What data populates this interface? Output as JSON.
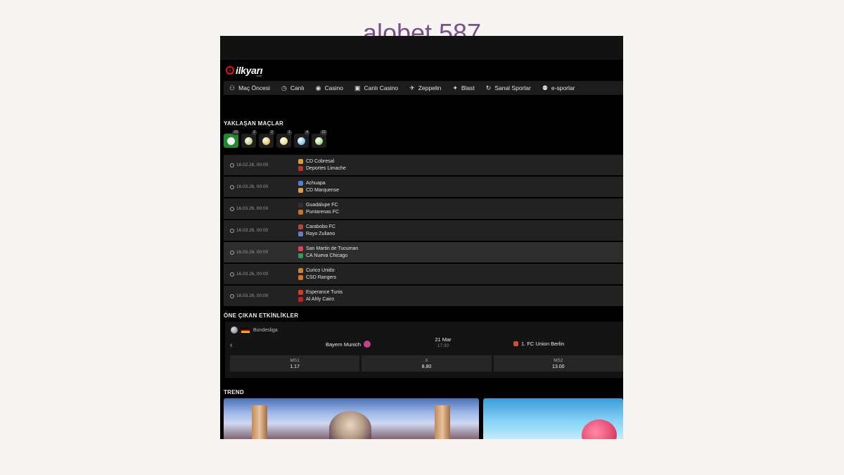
{
  "page_title": "alobet 587",
  "site": {
    "logo_text": "ilkyarı",
    "logo_sub": ".com"
  },
  "nav": [
    {
      "label": "Maç Öncesi",
      "icon": "users-icon",
      "glyph": "⚇"
    },
    {
      "label": "Canlı",
      "icon": "stopwatch-icon",
      "glyph": "◷"
    },
    {
      "label": "Casino",
      "icon": "chip-icon",
      "glyph": "◉"
    },
    {
      "label": "Canlı Casino",
      "icon": "dealer-icon",
      "glyph": "▣"
    },
    {
      "label": "Zeppelin",
      "icon": "zeppelin-icon",
      "glyph": "✈"
    },
    {
      "label": "Blast",
      "icon": "rocket-icon",
      "glyph": "✦"
    },
    {
      "label": "Sanal Sporlar",
      "icon": "virtual-sports-icon",
      "glyph": "↻"
    },
    {
      "label": "e-sporlar",
      "icon": "gamepad-icon",
      "glyph": "⚉"
    }
  ],
  "upcoming": {
    "title": "YAKLAŞAN MAÇLAR",
    "sport_tabs": [
      {
        "name": "soccer",
        "count": "19",
        "color": "#f0f0f0"
      },
      {
        "name": "tennis",
        "count": "2",
        "color": "#a8b44a"
      },
      {
        "name": "basketball",
        "count": "2",
        "color": "#e0a020"
      },
      {
        "name": "volleyball",
        "count": "1",
        "color": "#e8c050"
      },
      {
        "name": "ice-hockey",
        "count": "4",
        "color": "#4aa0d8"
      },
      {
        "name": "table-tennis",
        "count": "12",
        "color": "#7ec850"
      }
    ],
    "matches": [
      {
        "time": "16.02.26, 00:00",
        "home": "CD Cobresal",
        "away": "Deportes Limache",
        "home_color": "#e0a030",
        "away_color": "#c03030"
      },
      {
        "time": "16.03.26, 00:00",
        "home": "Achuapa",
        "away": "CD Marquense",
        "home_color": "#5080d0",
        "away_color": "#d8a040"
      },
      {
        "time": "16.03.26, 00:00",
        "home": "Guadalupe FC",
        "away": "Puntarenas FC",
        "home_color": "#303030",
        "away_color": "#d07030"
      },
      {
        "time": "16.03.26, 00:00",
        "home": "Carabobo FC",
        "away": "Rayo Zuliano",
        "home_color": "#c04040",
        "away_color": "#6080c0"
      },
      {
        "time": "16.03.26, 00:00",
        "home": "San Martin de Tucuman",
        "away": "CA Nueva Chicago",
        "home_color": "#e04050",
        "away_color": "#30a050"
      },
      {
        "time": "16.03.26, 00:00",
        "home": "Curico Unido",
        "away": "CSD Rangers",
        "home_color": "#d08030",
        "away_color": "#e07020"
      },
      {
        "time": "16.03.26, 00:00",
        "home": "Esperance Tunis",
        "away": "Al Ahly Cairo",
        "home_color": "#d04020",
        "away_color": "#c02020"
      }
    ]
  },
  "featured": {
    "title": "ÖNE ÇIKAN ETKİNLİKLER",
    "league": "Bundesliga",
    "home": "Bayern Munich",
    "away": "1. FC Union Berlin",
    "date": "21 Mar",
    "time": "17:30",
    "odds": [
      {
        "label": "MS1",
        "value": "1.17"
      },
      {
        "label": "X",
        "value": "8.80"
      },
      {
        "label": "MS2",
        "value": "13.00"
      }
    ]
  },
  "trend": {
    "title": "TREND"
  }
}
